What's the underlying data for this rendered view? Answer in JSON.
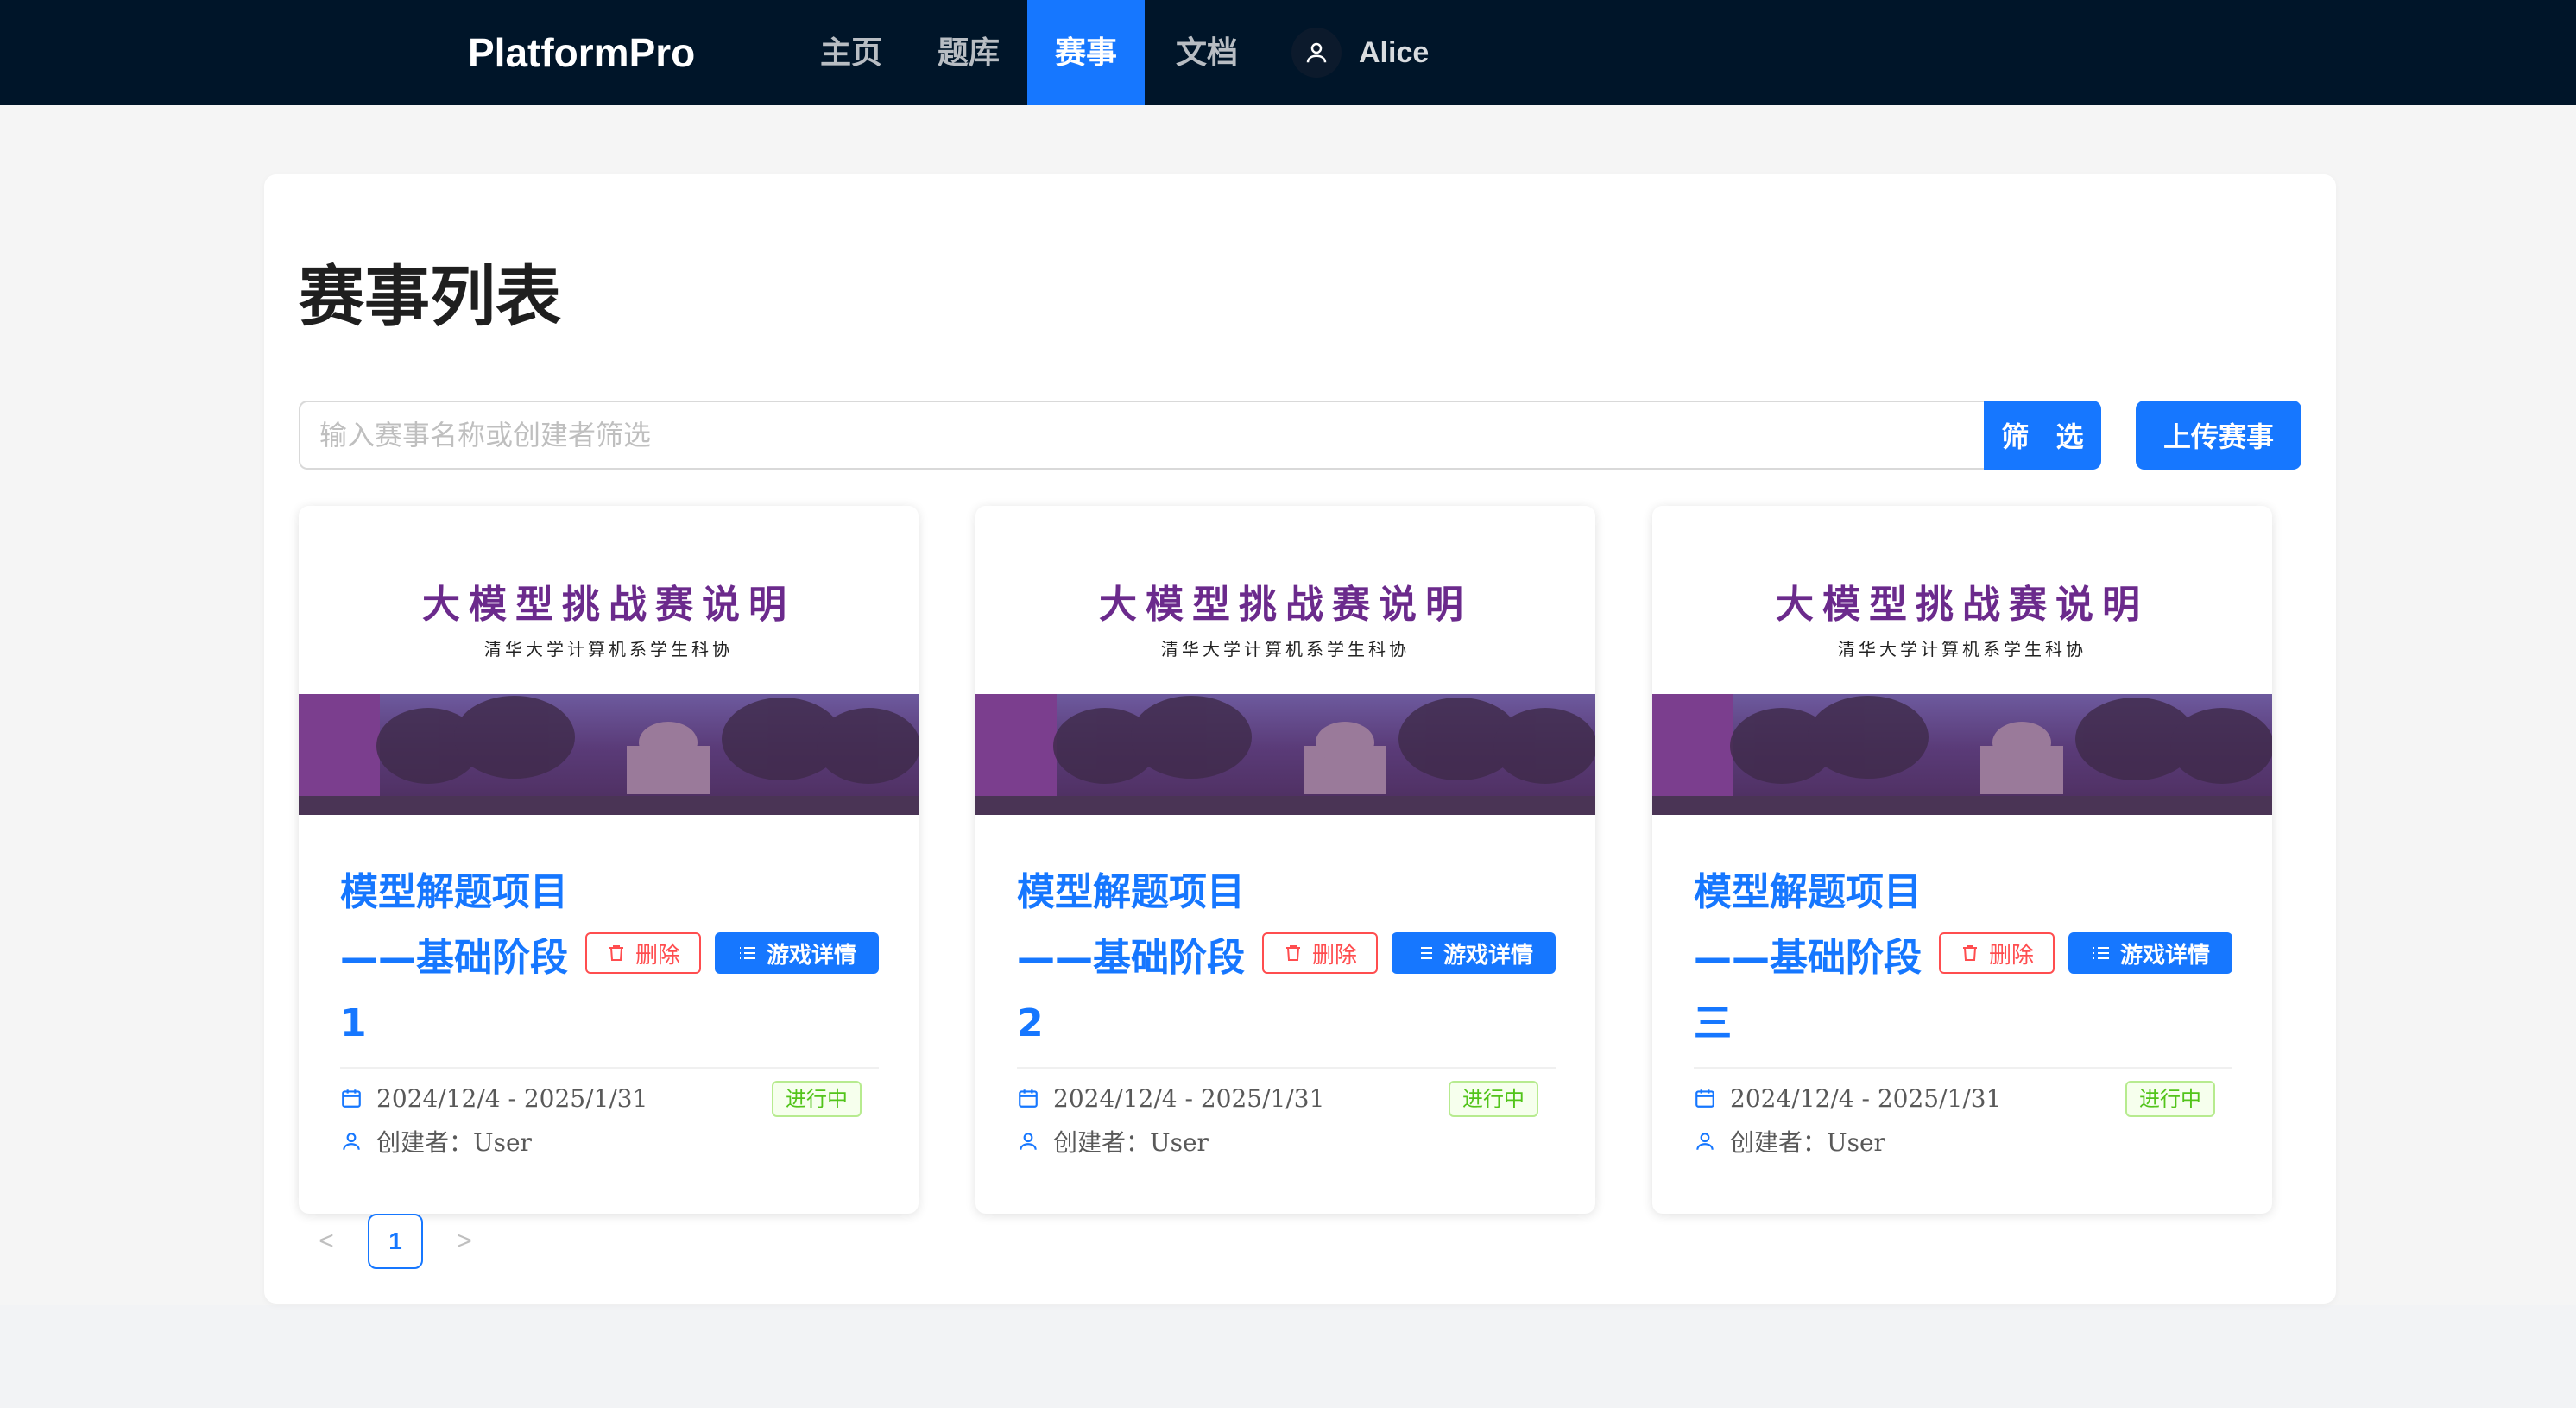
{
  "nav": {
    "brand": "PlatformPro",
    "items": [
      {
        "label": "主页",
        "active": false
      },
      {
        "label": "题库",
        "active": false
      },
      {
        "label": "赛事",
        "active": true
      },
      {
        "label": "文档",
        "active": false
      }
    ],
    "user": {
      "name": "Alice",
      "icon": "user-icon"
    }
  },
  "page": {
    "title": "赛事列表",
    "search_placeholder": "输入赛事名称或创建者筛选",
    "search_value": "",
    "filter_label": "筛 选",
    "upload_label": "上传赛事"
  },
  "cover": {
    "title": "大模型挑战赛说明",
    "subtitle": "清华大学计算机系学生科协"
  },
  "cards": [
    {
      "title": "模型解题项目——基础阶段1",
      "delete_label": "删除",
      "detail_label": "游戏详情",
      "date_range": "2024/12/4 - 2025/1/31",
      "creator": "创建者：User",
      "status": "进行中"
    },
    {
      "title": "模型解题项目——基础阶段2",
      "delete_label": "删除",
      "detail_label": "游戏详情",
      "date_range": "2024/12/4 - 2025/1/31",
      "creator": "创建者：User",
      "status": "进行中"
    },
    {
      "title": "模型解题项目——基础阶段三",
      "delete_label": "删除",
      "detail_label": "游戏详情",
      "date_range": "2024/12/4 - 2025/1/31",
      "creator": "创建者：User",
      "status": "进行中"
    }
  ],
  "pagination": {
    "prev": "<",
    "current": "1",
    "next": ">"
  },
  "colors": {
    "nav_bg": "#001529",
    "primary": "#1677ff",
    "danger": "#ff4d4f",
    "success": "#52c41a",
    "cover_purple": "#6b2a8c"
  }
}
